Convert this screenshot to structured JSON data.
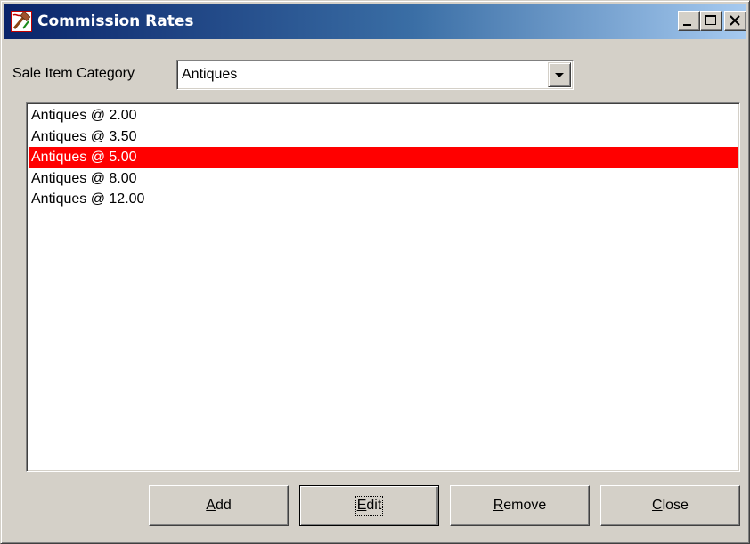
{
  "window": {
    "title": "Commission Rates",
    "app_icon": "gavel-pen-icon"
  },
  "category": {
    "label": "Sale Item Category",
    "selected": "Antiques"
  },
  "rates": {
    "items": [
      {
        "label": "Antiques @ 2.00",
        "selected": false
      },
      {
        "label": "Antiques @ 3.50",
        "selected": false
      },
      {
        "label": "Antiques @ 5.00",
        "selected": true
      },
      {
        "label": "Antiques @ 8.00",
        "selected": false
      },
      {
        "label": "Antiques @ 12.00",
        "selected": false
      }
    ]
  },
  "buttons": {
    "add": {
      "mnemonic": "A",
      "rest": "dd"
    },
    "edit": {
      "mnemonic": "E",
      "rest": "dit"
    },
    "remove": {
      "mnemonic": "R",
      "rest": "emove"
    },
    "close": {
      "mnemonic": "C",
      "rest": "lose"
    }
  },
  "colors": {
    "selection": "#ff0000",
    "titlebar_start": "#0a246a",
    "titlebar_end": "#a6caf0",
    "face": "#d4d0c8"
  }
}
